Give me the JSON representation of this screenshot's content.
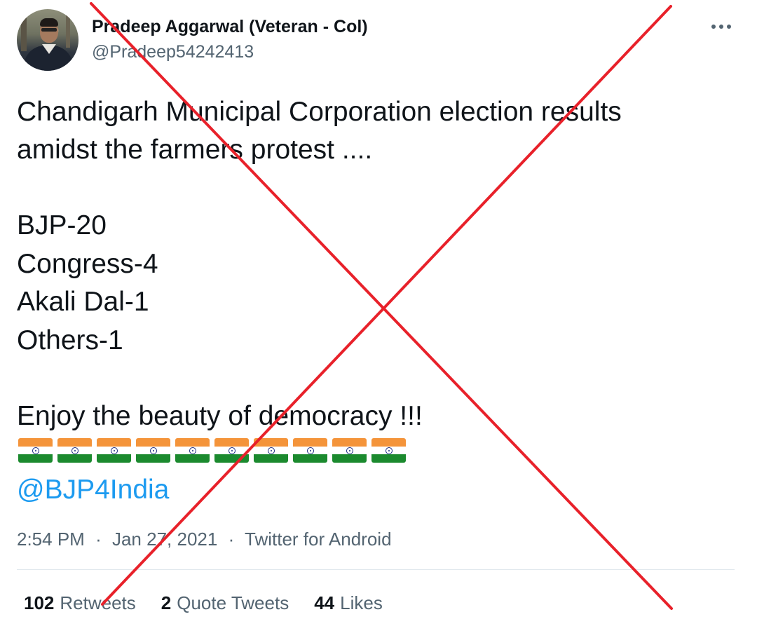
{
  "author": {
    "display_name": "Pradeep Aggarwal (Veteran - Col)",
    "handle": "@Pradeep54242413"
  },
  "tweet": {
    "lines_intro": [
      "Chandigarh Municipal Corporation election results",
      "amidst the farmers protest ...."
    ],
    "results": [
      "BJP-20",
      "Congress-4",
      "Akali Dal-1",
      "Others-1"
    ],
    "closing": "Enjoy the beauty of democracy !!!",
    "flag_emoji_count": 10,
    "mention": "@BJP4India"
  },
  "meta": {
    "time": "2:54 PM",
    "date": "Jan 27, 2021",
    "separator": "·",
    "source": "Twitter for Android"
  },
  "stats": {
    "retweets_count": "102",
    "retweets_label": "Retweets",
    "quotes_count": "2",
    "quotes_label": "Quote Tweets",
    "likes_count": "44",
    "likes_label": "Likes"
  },
  "colors": {
    "text": "#0f1419",
    "secondary": "#536471",
    "link": "#1d9bf0",
    "cross": "#e8212a",
    "saffron": "#f4943a",
    "green": "#1b8a2e"
  },
  "icons": {
    "more": "more-horizontal-icon",
    "flag": "india-flag-emoji"
  }
}
